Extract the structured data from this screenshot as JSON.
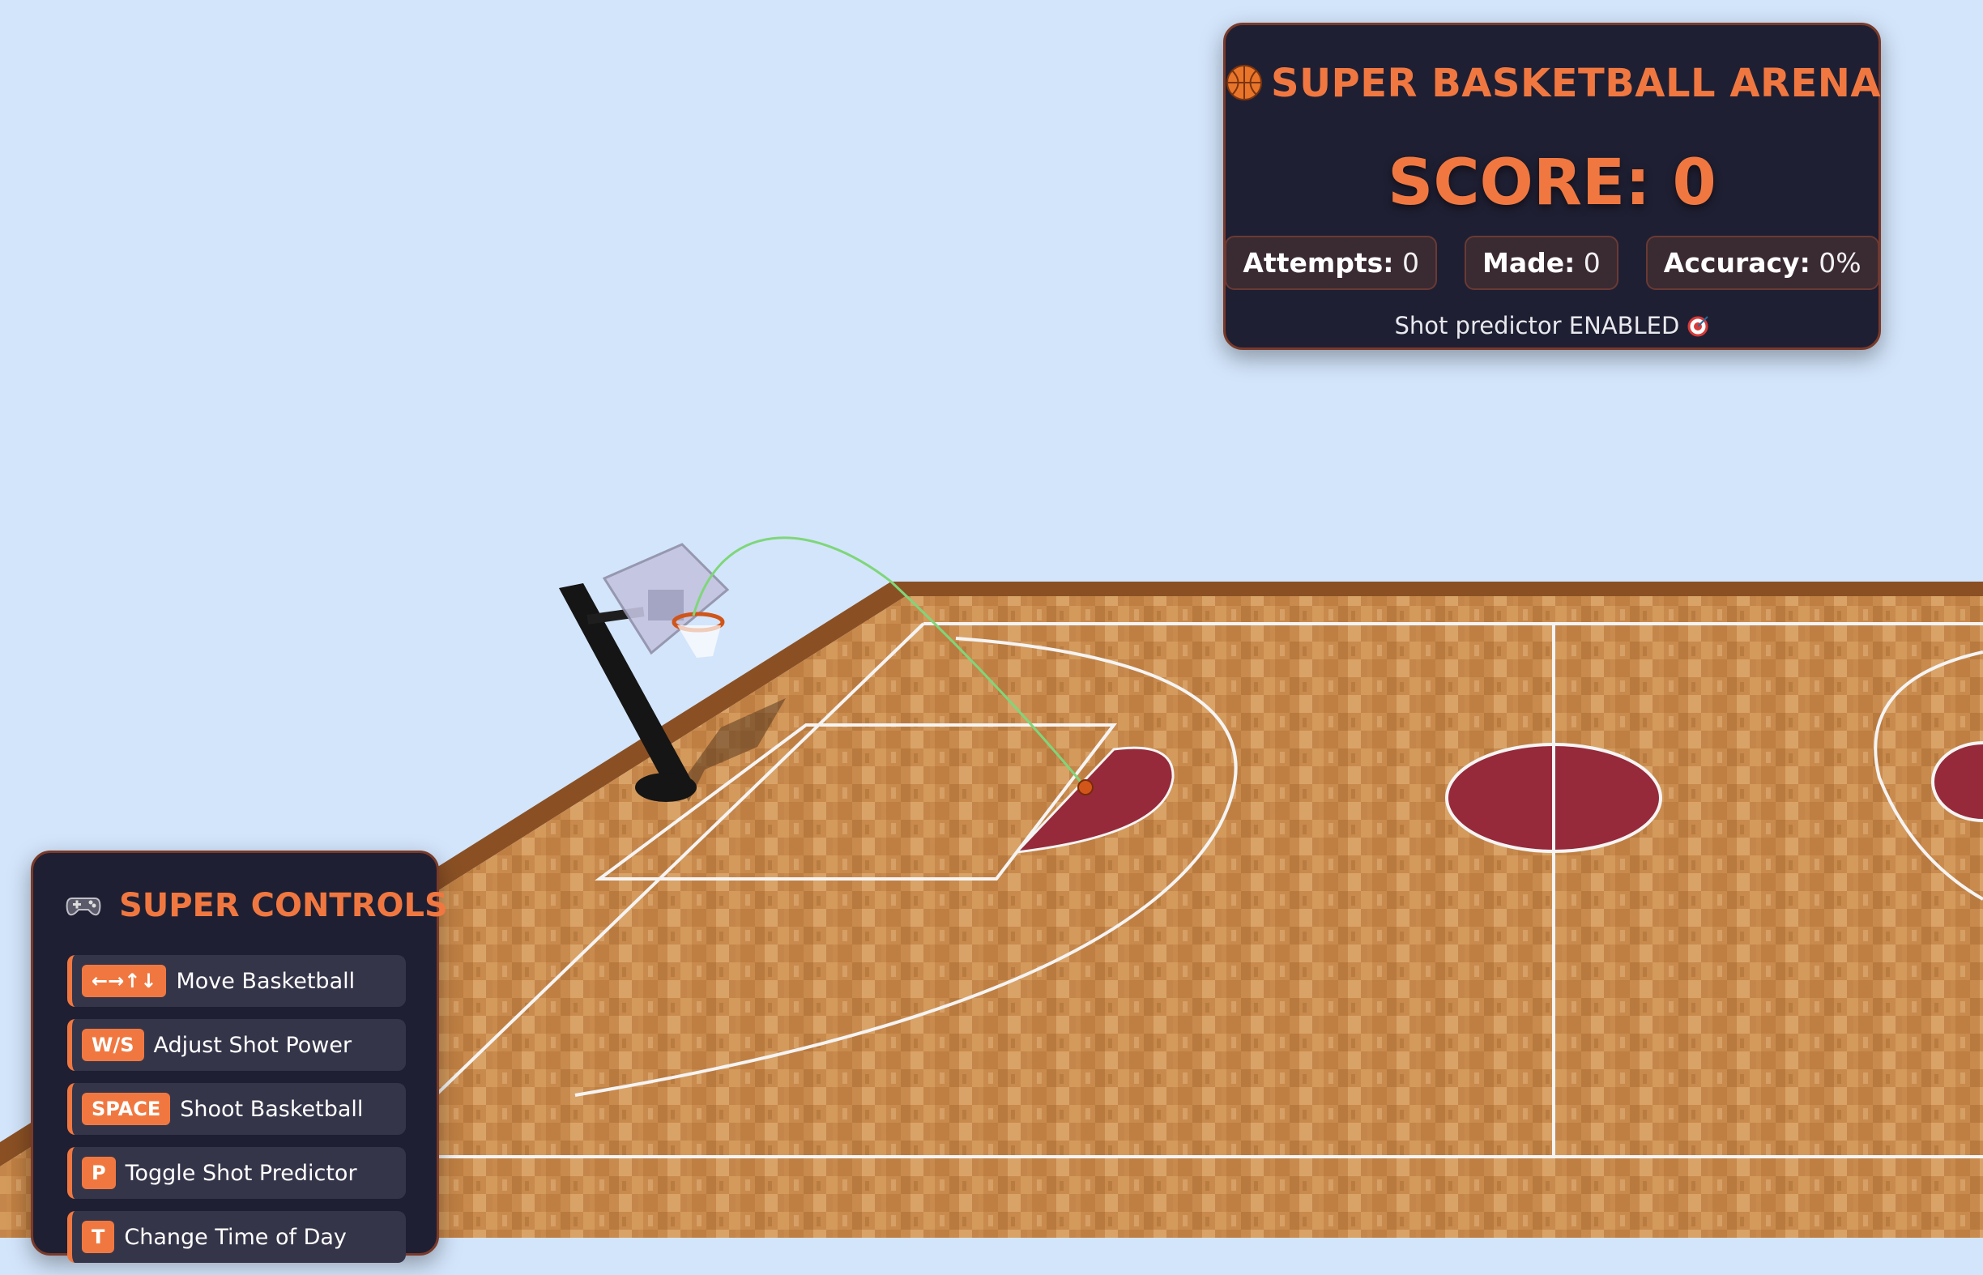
{
  "hud": {
    "title": "SUPER BASKETBALL ARENA",
    "title_icon": "basketball-icon",
    "score_label": "SCORE: 0",
    "attempts_label": "Attempts:",
    "attempts_value": "0",
    "made_label": "Made:",
    "made_value": "0",
    "accuracy_label": "Accuracy:",
    "accuracy_value": "0%",
    "status": "Shot predictor ENABLED",
    "status_icon": "target-icon"
  },
  "controls": {
    "title": "SUPER CONTROLS",
    "title_icon": "gamepad-icon",
    "items": [
      {
        "key": "←→↑↓",
        "label": "Move Basketball"
      },
      {
        "key": "W/S",
        "label": "Adjust Shot Power"
      },
      {
        "key": "SPACE",
        "label": "Shoot Basketball"
      },
      {
        "key": "P",
        "label": "Toggle Shot Predictor"
      },
      {
        "key": "T",
        "label": "Change Time of Day"
      }
    ]
  },
  "colors": {
    "sky": "#d3e5fb",
    "panel": "#1f1f33",
    "accent": "#f07840",
    "court_wood": "#c8884a",
    "paint_circle": "#962a3a",
    "trajectory": "#7fd67a"
  }
}
